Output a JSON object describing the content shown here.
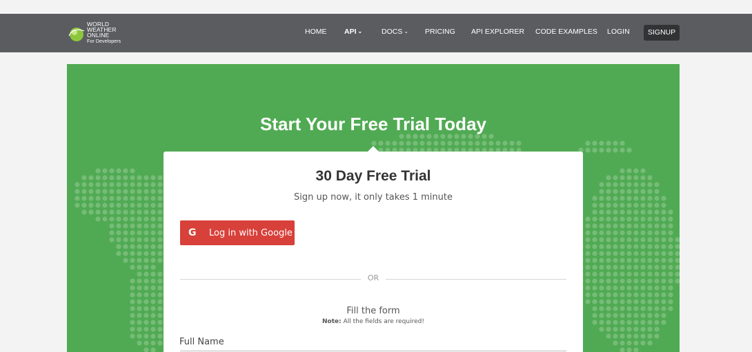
{
  "brand": {
    "line1": "WORLD",
    "line2": "WEATHER",
    "line3": "ONLINE",
    "tagline": "For Developers"
  },
  "nav": {
    "items": [
      {
        "label": "HOME",
        "bold": false,
        "dropdown": false
      },
      {
        "label": "API",
        "bold": true,
        "dropdown": true
      },
      {
        "label": "DOCS",
        "bold": false,
        "dropdown": true
      },
      {
        "label": "PRICING",
        "bold": false,
        "dropdown": false
      },
      {
        "label": "API EXPLORER",
        "bold": false,
        "dropdown": false
      },
      {
        "label": "CODE EXAMPLES",
        "bold": false,
        "dropdown": false
      },
      {
        "label": "LOGIN",
        "bold": false,
        "dropdown": false
      }
    ],
    "signup_label": "SIGNUP"
  },
  "hero": {
    "title": "Start Your Free Trial Today"
  },
  "card": {
    "title": "30 Day Free Trial",
    "subtitle": "Sign up now, it only takes 1 minute",
    "google_icon": "G",
    "google_label": "Log in with Google",
    "or_label": "OR",
    "form_title": "Fill the form",
    "note_label": "Note:",
    "note_text": " All the fields are required!",
    "full_name_label": "Full Name"
  },
  "colors": {
    "navbar": "#5b5c60",
    "hero_green": "#50aa53",
    "google_red": "#d8403a",
    "signup_bg": "#323335"
  }
}
